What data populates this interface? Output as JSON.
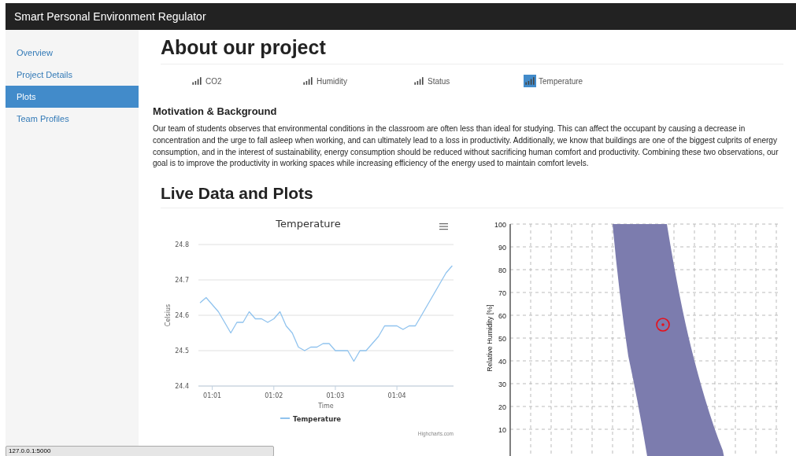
{
  "navbar": {
    "brand": "Smart Personal Environment Regulator"
  },
  "sidebar": {
    "items": [
      {
        "label": "Overview",
        "selected": false
      },
      {
        "label": "Project Details",
        "selected": false
      },
      {
        "label": "Plots",
        "selected": true
      },
      {
        "label": "Team Profiles",
        "selected": false
      }
    ]
  },
  "page_title": "About our project",
  "tabs": [
    {
      "label": "CO2",
      "selected": false
    },
    {
      "label": "Humidity",
      "selected": false
    },
    {
      "label": "Status",
      "selected": false
    },
    {
      "label": "Temperature",
      "selected": true
    }
  ],
  "motivation": {
    "heading": "Motivation & Background",
    "text": "Our team of students observes that environmental conditions in the classroom are often less than ideal for studying. This can affect the occupant by causing a decrease in concentration and the urge to fall asleep when working, and can ultimately lead to a loss in productivity. Additionally, we know that buildings are one of the biggest culprits of energy consumption, and in the interest of sustainability, energy consumption should be reduced without sacrificing human comfort and productivity. Combining these two observations, our goal is to improve the productivity in working spaces while increasing efficiency of the energy used to maintain comfort levels."
  },
  "live_heading": "Live Data and Plots",
  "temperature_chart": {
    "credits": "Highcharts.com",
    "chart_data": {
      "type": "line",
      "title": "Temperature",
      "xlabel": "Time",
      "ylabel": "Celsius",
      "categories": [
        null,
        null,
        "01:01",
        null,
        null,
        null,
        null,
        null,
        null,
        null,
        null,
        null,
        "01:02",
        null,
        null,
        null,
        null,
        null,
        null,
        null,
        null,
        null,
        "01:03",
        null,
        null,
        null,
        null,
        null,
        null,
        null,
        null,
        null,
        "01:04",
        null,
        null,
        null,
        null,
        null,
        null,
        null,
        null,
        null
      ],
      "series": [
        {
          "name": "Temperature",
          "color": "#90c3ee",
          "values": [
            24.635,
            24.65,
            24.63,
            24.61,
            24.58,
            24.55,
            24.58,
            24.58,
            24.61,
            24.59,
            24.59,
            24.58,
            24.59,
            24.61,
            24.57,
            24.55,
            24.51,
            24.5,
            24.51,
            24.51,
            24.52,
            24.52,
            24.5,
            24.5,
            24.5,
            24.47,
            24.5,
            24.5,
            24.52,
            24.54,
            24.57,
            24.57,
            24.57,
            24.56,
            24.57,
            24.57,
            24.6,
            24.63,
            24.66,
            24.69,
            24.72,
            24.74
          ]
        }
      ],
      "ylim": [
        24.4,
        24.8
      ],
      "grid": true,
      "yticks": [
        24.4,
        24.5,
        24.6,
        24.7,
        24.8
      ]
    }
  },
  "comfort_chart": {
    "ylabel": "Relative Humidity [%]",
    "yticks": [
      "100",
      "90",
      "80",
      "70",
      "60",
      "50",
      "40",
      "30",
      "20",
      "10"
    ]
  },
  "status_url": "127.0.0.1:5000"
}
